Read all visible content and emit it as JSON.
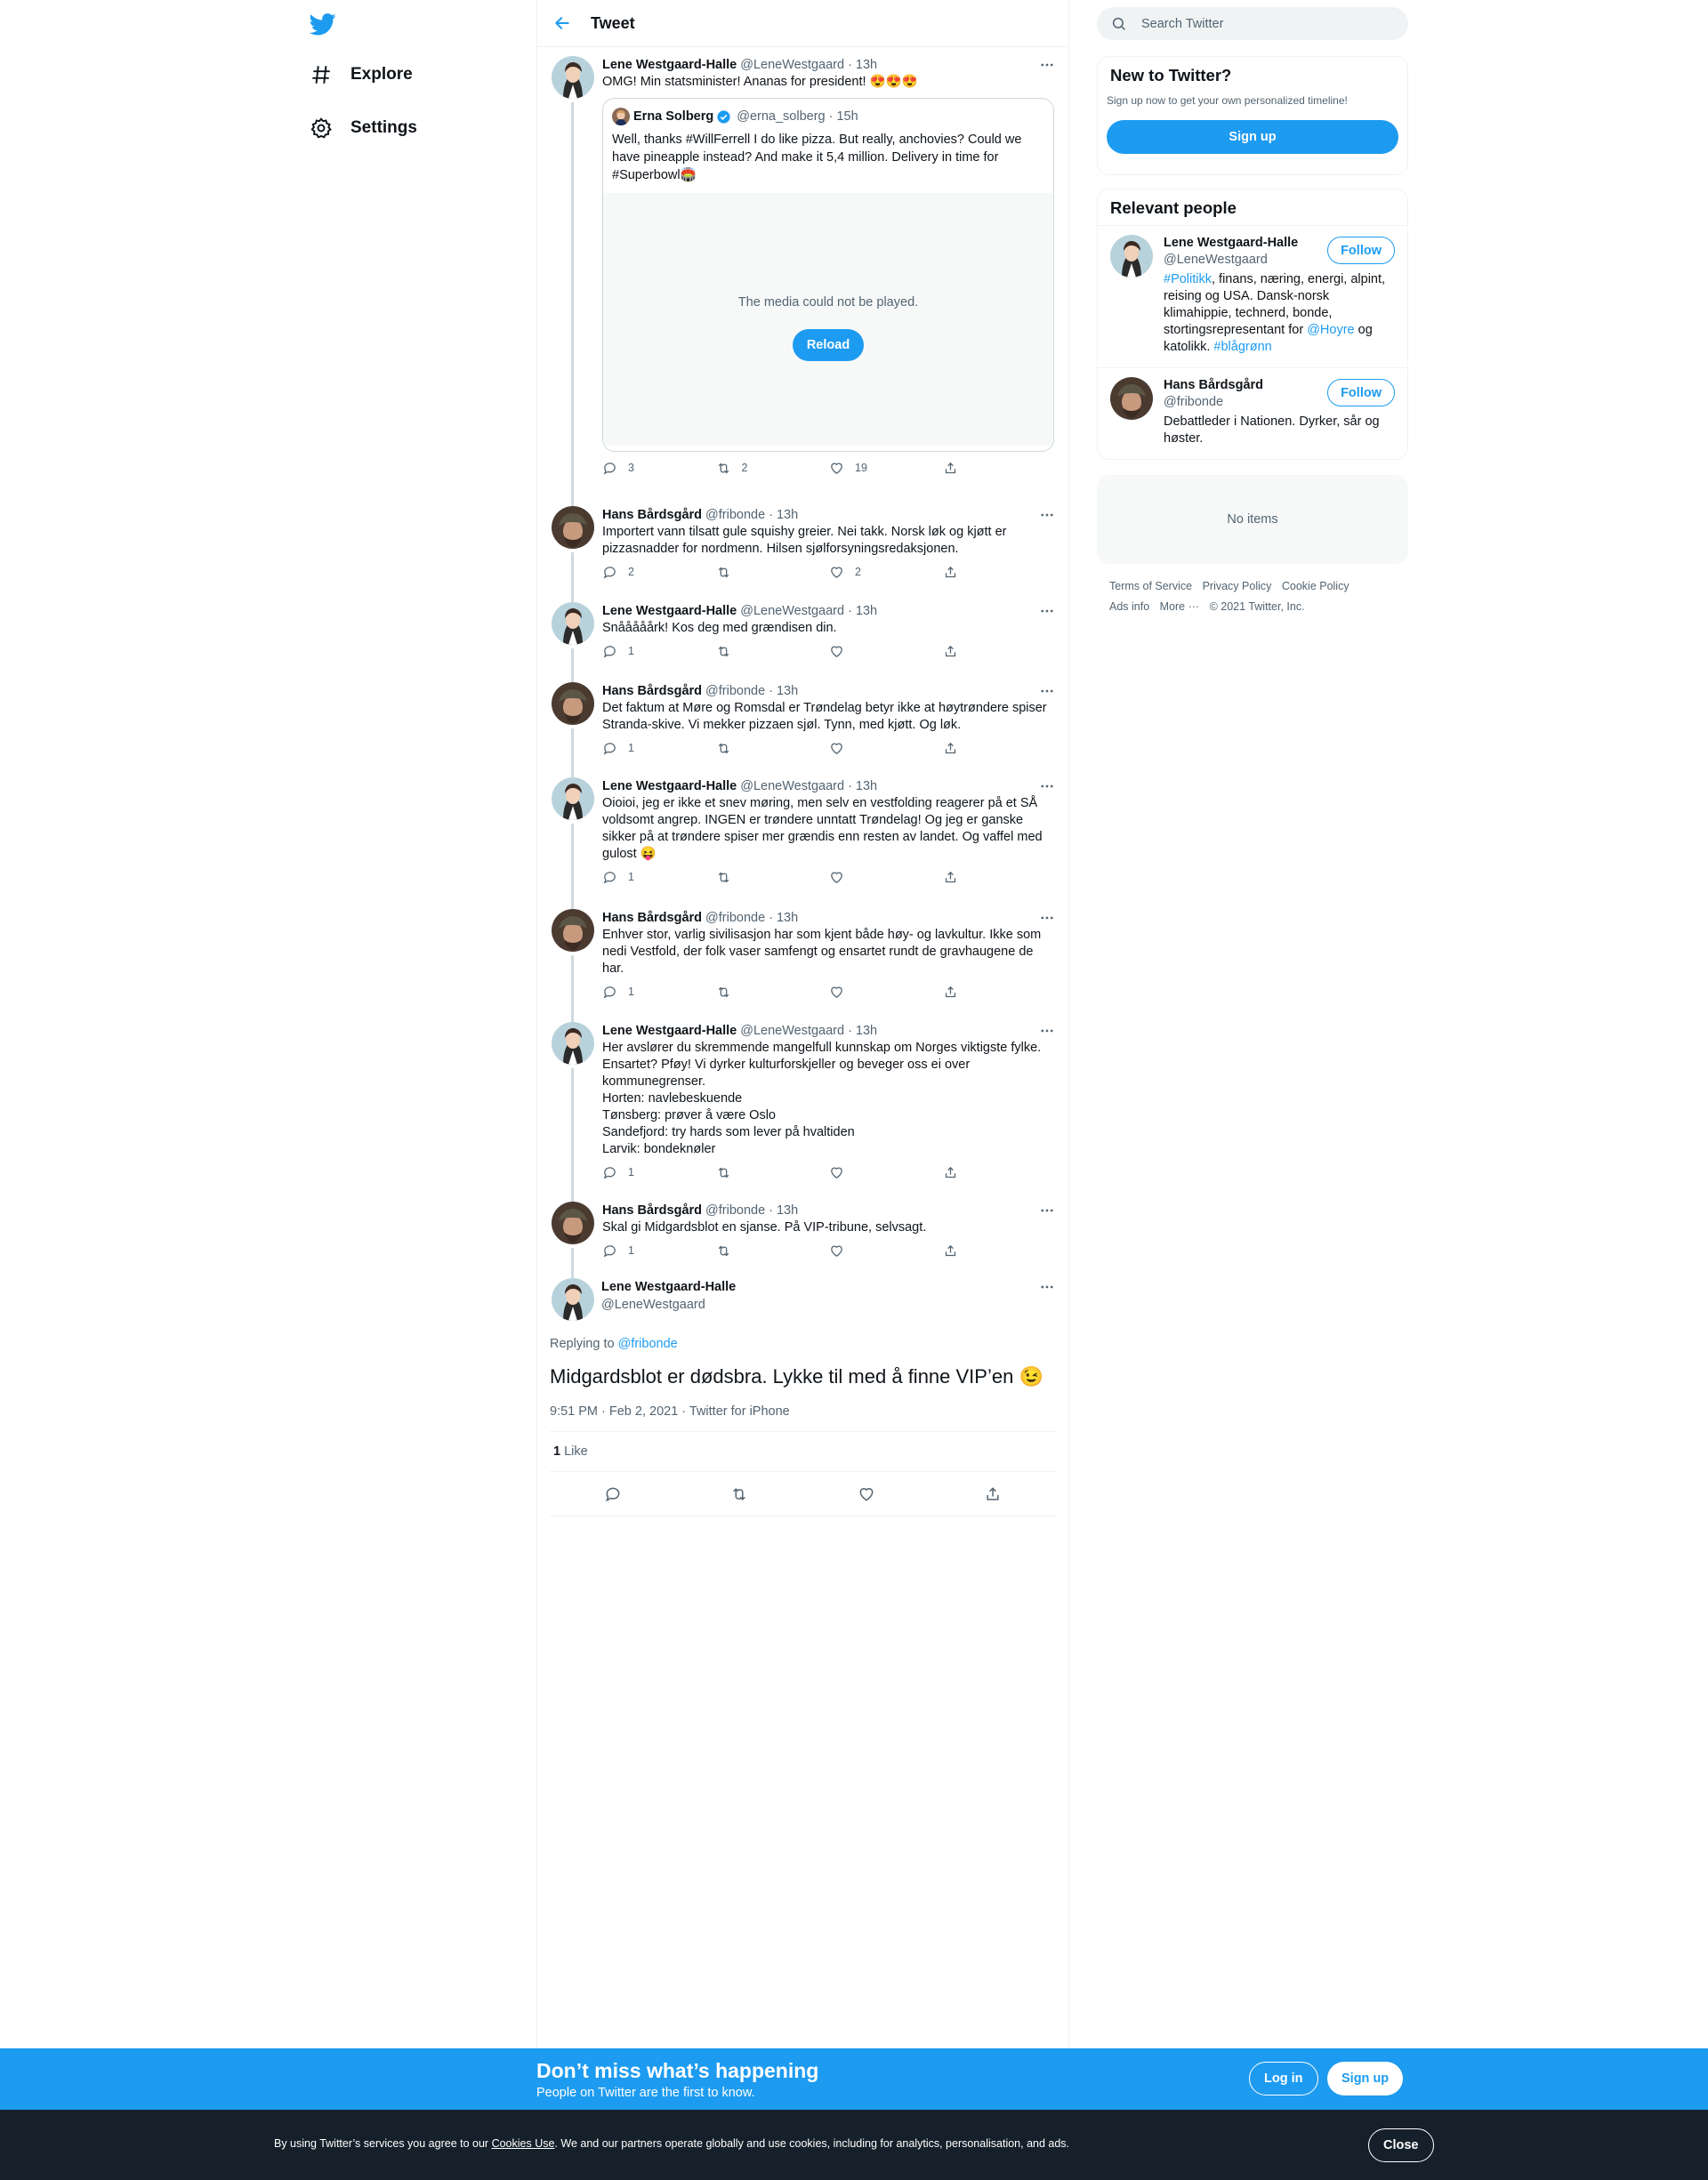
{
  "colors": {
    "accent": "#1d9bf0",
    "text": "#0f1419",
    "muted": "#536471",
    "bottom_bar": "#1d9bf0",
    "cookie_bar": "#15202b"
  },
  "nav": {
    "explore": "Explore",
    "settings": "Settings"
  },
  "header": {
    "title": "Tweet"
  },
  "thread": [
    {
      "name": "Lene Westgaard-Halle",
      "handle": "@LeneWestgaard",
      "time": "13h",
      "text": "OMG! Min statsminister! Ananas for president! 😍😍😍",
      "quote": {
        "name": "Erna Solberg",
        "handle": "@erna_solberg",
        "time": "15h",
        "text": "Well, thanks #WillFerrell I do like pizza. But really, anchovies? Could we have pineapple instead? And make it 5,4 million. Delivery in time for #Superbowl🏟️",
        "media_error": "The media could not be played.",
        "reload": "Reload"
      },
      "replies": "3",
      "retweets": "2",
      "likes": "19"
    },
    {
      "name": "Hans Bårdsgård",
      "handle": "@fribonde",
      "time": "13h",
      "text": "Importert vann tilsatt gule squishy greier. Nei takk. Norsk løk og kjøtt er pizzasnadder for nordmenn. Hilsen sjølforsyningsredaksjonen.",
      "replies": "2",
      "retweets": "",
      "likes": "2"
    },
    {
      "name": "Lene Westgaard-Halle",
      "handle": "@LeneWestgaard",
      "time": "13h",
      "text": "Snååååårk! Kos deg med grændisen din.",
      "replies": "1",
      "retweets": "",
      "likes": ""
    },
    {
      "name": "Hans Bårdsgård",
      "handle": "@fribonde",
      "time": "13h",
      "text": "Det faktum at Møre og Romsdal er Trøndelag betyr ikke at høytrøndere spiser Stranda-skive. Vi mekker pizzaen sjøl. Tynn, med kjøtt. Og løk.",
      "replies": "1",
      "retweets": "",
      "likes": ""
    },
    {
      "name": "Lene Westgaard-Halle",
      "handle": "@LeneWestgaard",
      "time": "13h",
      "text": "Oioioi, jeg er ikke et snev møring, men selv en vestfolding reagerer på et SÅ voldsomt angrep. INGEN er trøndere unntatt Trøndelag! Og jeg er ganske sikker på at trøndere spiser mer grændis enn resten av landet. Og vaffel med gulost 😝",
      "replies": "1",
      "retweets": "",
      "likes": ""
    },
    {
      "name": "Hans Bårdsgård",
      "handle": "@fribonde",
      "time": "13h",
      "text": "Enhver stor, varlig sivilisasjon har som kjent både høy- og lavkultur. Ikke som nedi Vestfold, der folk vaser samfengt og ensartet rundt de gravhaugene de har.",
      "replies": "1",
      "retweets": "",
      "likes": ""
    },
    {
      "name": "Lene Westgaard-Halle",
      "handle": "@LeneWestgaard",
      "time": "13h",
      "text": "Her avslører du skremmende mangelfull kunnskap om Norges viktigste fylke. Ensartet? Pføy! Vi dyrker kulturforskjeller og beveger oss ei over kommunegrenser.\nHorten: navlebeskuende\nTønsberg: prøver å være Oslo\nSandefjord: try hards som lever på hvaltiden\nLarvik: bondeknøler",
      "replies": "1",
      "retweets": "",
      "likes": ""
    },
    {
      "name": "Hans Bårdsgård",
      "handle": "@fribonde",
      "time": "13h",
      "text": "Skal gi Midgardsblot en sjanse. På VIP-tribune, selvsagt.",
      "replies": "1",
      "retweets": "",
      "likes": ""
    }
  ],
  "focused": {
    "name": "Lene Westgaard-Halle",
    "handle": "@LeneWestgaard",
    "replying_prefix": "Replying to",
    "replying_to": "@fribonde",
    "text": "Midgardsblot er dødsbra. Lykke til med å finne VIP’en 😉",
    "meta": "9:51 PM · Feb 2, 2021 · Twitter for iPhone",
    "likes_count": "1",
    "likes_label": "Like"
  },
  "sidebar": {
    "search_placeholder": "Search Twitter",
    "new_title": "New to Twitter?",
    "new_sub": "Sign up now to get your own personalized timeline!",
    "signup": "Sign up",
    "people_title": "Relevant people",
    "people": [
      {
        "name": "Lene Westgaard-Halle",
        "handle": "@LeneWestgaard",
        "follow": "Follow",
        "bio_parts": [
          "#Politikk",
          ", finans, næring, energi, alpint, reising og USA. Dansk-norsk klimahippie, technerd, bonde, stortingsrepresentant for ",
          "@Hoyre",
          " og katolikk. ",
          "#blågrønn"
        ]
      },
      {
        "name": "Hans Bårdsgård",
        "handle": "@fribonde",
        "follow": "Follow",
        "bio": "Debattleder i Nationen. Dyrker, sår og høster."
      }
    ],
    "no_items": "No items",
    "footer": [
      "Terms of Service",
      "Privacy Policy",
      "Cookie Policy",
      "Ads info",
      "More ···",
      "© 2021 Twitter, Inc."
    ]
  },
  "bottom_bar": {
    "title": "Don’t miss what’s happening",
    "subtitle": "People on Twitter are the first to know.",
    "login": "Log in",
    "signup": "Sign up"
  },
  "cookie_bar": {
    "text_before": "By using Twitter’s services you agree to our ",
    "link": "Cookies Use",
    "text_after": ". We and our partners operate globally and use cookies, including for analytics, personalisation, and ads.",
    "close": "Close"
  }
}
